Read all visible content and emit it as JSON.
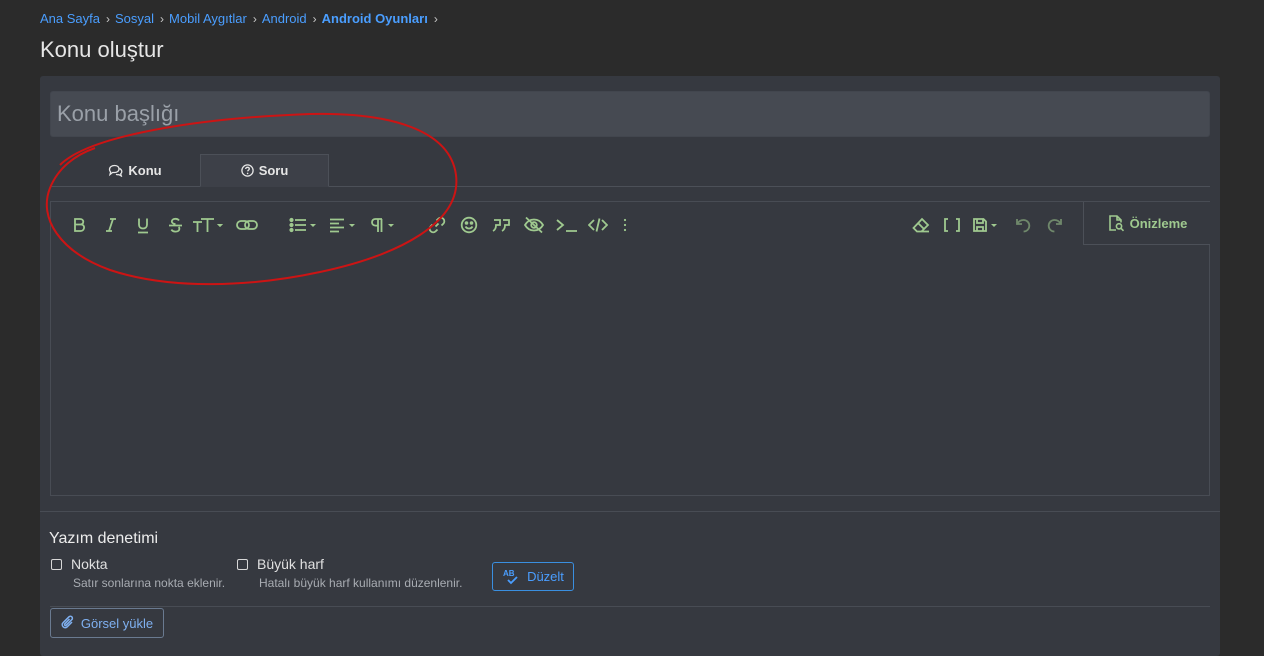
{
  "breadcrumb": [
    "Ana Sayfa",
    "Sosyal",
    "Mobil Aygıtlar",
    "Android",
    "Android Oyunları"
  ],
  "page_title": "Konu oluştur",
  "title_input": {
    "placeholder": "Konu başlığı",
    "value": ""
  },
  "tabs": [
    {
      "label": "Konu",
      "icon": "comments-icon",
      "active": false
    },
    {
      "label": "Soru",
      "icon": "question-circle-icon",
      "active": true
    }
  ],
  "toolbar": {
    "left": [
      "bold",
      "italic",
      "underline",
      "strikethrough",
      "font-size",
      "link-chain",
      "list",
      "align",
      "paragraph",
      "insert-link",
      "emoji",
      "quote",
      "spoiler",
      "inline-code",
      "code",
      "more"
    ],
    "right": [
      "remove-format",
      "bbcode-toggle",
      "drafts",
      "undo",
      "redo"
    ],
    "preview_label": "Önizleme"
  },
  "spell_check": {
    "title": "Yazım denetimi",
    "options": [
      {
        "label": "Nokta",
        "desc": "Satır sonlarına nokta eklenir.",
        "checked": false
      },
      {
        "label": "Büyük harf",
        "desc": "Hatalı büyük harf kullanımı düzenlenir.",
        "checked": false
      }
    ],
    "fix_button": "Düzelt",
    "fix_icon_text": "AB"
  },
  "upload_label": "Görsel yükle",
  "colors": {
    "link": "#4a9eff",
    "toolbar_icon": "#9fc98f",
    "annotation": "#d01818",
    "panel": "#363940"
  }
}
